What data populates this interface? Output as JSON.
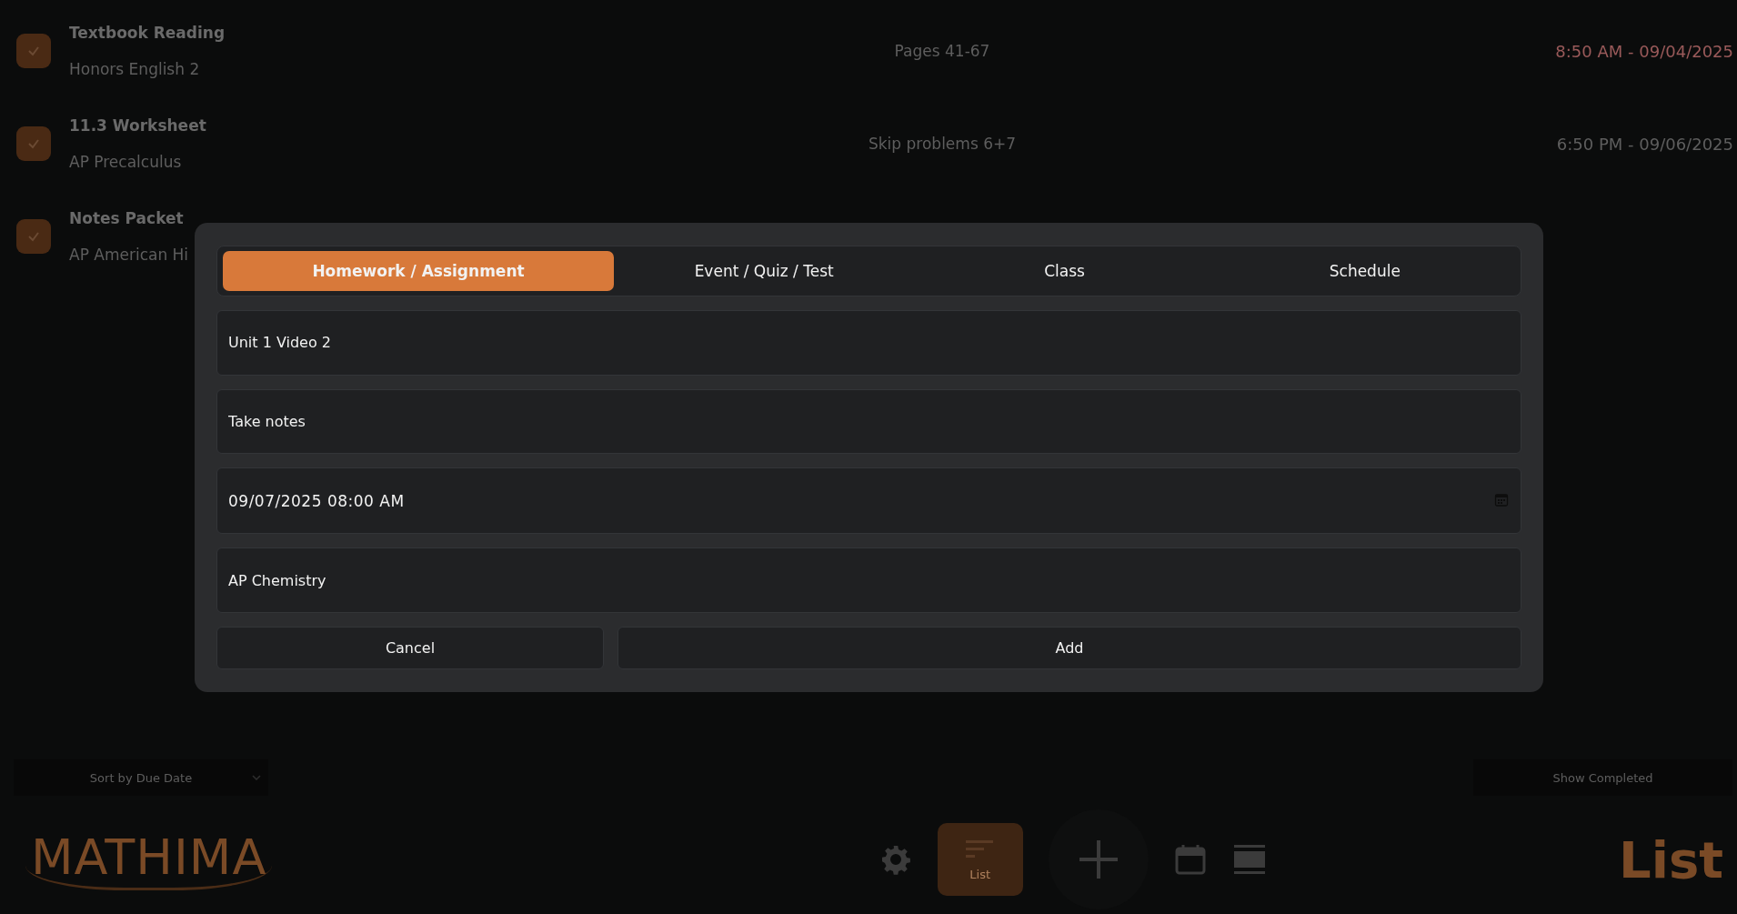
{
  "tasks": [
    {
      "title": "Textbook Reading",
      "course": "Honors English 2",
      "note": "Pages 41-67",
      "due": "8:50 AM - 09/04/2025",
      "overdue": true,
      "checked": true
    },
    {
      "title": "11.3 Worksheet",
      "course": "AP Precalculus",
      "note": "Skip problems 6+7",
      "due": "6:50 PM - 09/06/2025",
      "overdue": false,
      "checked": true
    },
    {
      "title": "Notes Packet",
      "course": "AP American Hi",
      "checked": true
    }
  ],
  "sort": {
    "value": "Sort by Due Date"
  },
  "show_completed": "Show Completed",
  "logo": "MATHIMA",
  "nav": [
    {
      "kind": "settings",
      "selected": false
    },
    {
      "kind": "list",
      "label": "List",
      "selected": true
    },
    {
      "kind": "add",
      "selected": false
    },
    {
      "kind": "calendar",
      "selected": false
    },
    {
      "kind": "schedule",
      "selected": false
    }
  ],
  "page_title": "List",
  "dialog": {
    "tabs": [
      {
        "label": "Homework / Assignment",
        "selected": true
      },
      {
        "label": "Event / Quiz / Test",
        "selected": false
      },
      {
        "label": "Class",
        "selected": false
      },
      {
        "label": "Schedule",
        "selected": false
      }
    ],
    "fields": [
      {
        "kind": "text",
        "value": "Unit 1 Video 2"
      },
      {
        "kind": "text",
        "value": "Take notes"
      },
      {
        "kind": "datetime",
        "value": "09/07/2025 08:00 AM"
      },
      {
        "kind": "text",
        "value": "AP Chemistry"
      }
    ],
    "buttons": [
      "Cancel",
      "Add"
    ]
  }
}
